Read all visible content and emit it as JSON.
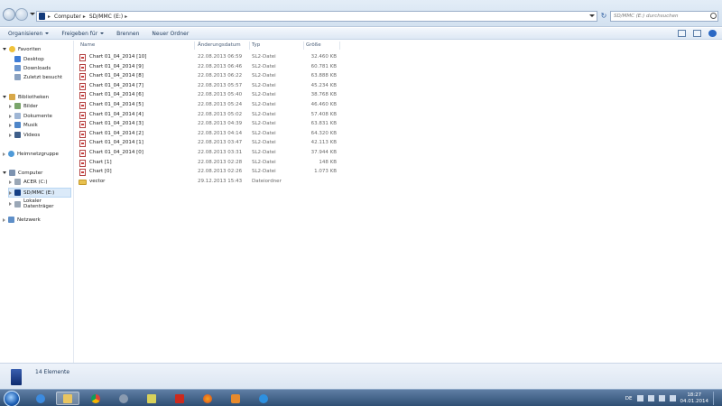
{
  "address": {
    "crumbs": [
      "Computer",
      "SD/MMC (E:)"
    ]
  },
  "search": {
    "placeholder": "SD/MMC (E:) durchsuchen"
  },
  "toolbar": {
    "organize": "Organisieren",
    "share": "Freigeben für",
    "burn": "Brennen",
    "new_folder": "Neuer Ordner"
  },
  "sidebar": {
    "favorites": "Favoriten",
    "desktop": "Desktop",
    "downloads": "Downloads",
    "recent": "Zuletzt besucht",
    "libraries": "Bibliotheken",
    "pictures": "Bilder",
    "documents": "Dokumente",
    "music": "Musik",
    "videos": "Videos",
    "homegroup": "Heimnetzgruppe",
    "computer": "Computer",
    "drive_c": "ACER (C:)",
    "drive_e": "SD/MMC (E:)",
    "drive_local": "Lokaler Datenträger",
    "network": "Netzwerk"
  },
  "columns": {
    "name": "Name",
    "date": "Änderungsdatum",
    "type": "Typ",
    "size": "Größe"
  },
  "files": [
    {
      "name": "Chart 01_04_2014 [10]",
      "date": "22.08.2013 06:59",
      "type": "SL2-Datei",
      "size": "32.460 KB",
      "kind": "file"
    },
    {
      "name": "Chart 01_04_2014 [9]",
      "date": "22.08.2013 06:46",
      "type": "SL2-Datei",
      "size": "60.781 KB",
      "kind": "file"
    },
    {
      "name": "Chart 01_04_2014 [8]",
      "date": "22.08.2013 06:22",
      "type": "SL2-Datei",
      "size": "63.888 KB",
      "kind": "file"
    },
    {
      "name": "Chart 01_04_2014 [7]",
      "date": "22.08.2013 05:57",
      "type": "SL2-Datei",
      "size": "45.234 KB",
      "kind": "file"
    },
    {
      "name": "Chart 01_04_2014 [6]",
      "date": "22.08.2013 05:40",
      "type": "SL2-Datei",
      "size": "38.768 KB",
      "kind": "file"
    },
    {
      "name": "Chart 01_04_2014 [5]",
      "date": "22.08.2013 05:24",
      "type": "SL2-Datei",
      "size": "46.460 KB",
      "kind": "file"
    },
    {
      "name": "Chart 01_04_2014 [4]",
      "date": "22.08.2013 05:02",
      "type": "SL2-Datei",
      "size": "57.408 KB",
      "kind": "file"
    },
    {
      "name": "Chart 01_04_2014 [3]",
      "date": "22.08.2013 04:39",
      "type": "SL2-Datei",
      "size": "63.831 KB",
      "kind": "file"
    },
    {
      "name": "Chart 01_04_2014 [2]",
      "date": "22.08.2013 04:14",
      "type": "SL2-Datei",
      "size": "64.320 KB",
      "kind": "file"
    },
    {
      "name": "Chart 01_04_2014 [1]",
      "date": "22.08.2013 03:47",
      "type": "SL2-Datei",
      "size": "42.113 KB",
      "kind": "file"
    },
    {
      "name": "Chart 01_04_2014 [0]",
      "date": "22.08.2013 03:31",
      "type": "SL2-Datei",
      "size": "37.944 KB",
      "kind": "file"
    },
    {
      "name": "Chart [1]",
      "date": "22.08.2013 02:28",
      "type": "SL2-Datei",
      "size": "148 KB",
      "kind": "file"
    },
    {
      "name": "Chart [0]",
      "date": "22.08.2013 02:26",
      "type": "SL2-Datei",
      "size": "1.073 KB",
      "kind": "file"
    },
    {
      "name": "vector",
      "date": "29.12.2013 15:43",
      "type": "Dateiordner",
      "size": "",
      "kind": "folder"
    }
  ],
  "status": {
    "count": "14 Elemente"
  },
  "taskbar": {
    "lang": "DE",
    "time": "18:27",
    "date": "04.01.2014"
  },
  "icons": {
    "back": "back-arrow-icon",
    "forward": "forward-arrow-icon",
    "refresh": "refresh-icon",
    "search": "search-icon",
    "file": "sl2-file-icon",
    "folder": "folder-icon",
    "drive": "sd-card-drive-icon"
  },
  "colors": {
    "toolbar_text": "#1e395b",
    "selection": "#dbeaf9",
    "taskbar": "#2f4f74"
  }
}
